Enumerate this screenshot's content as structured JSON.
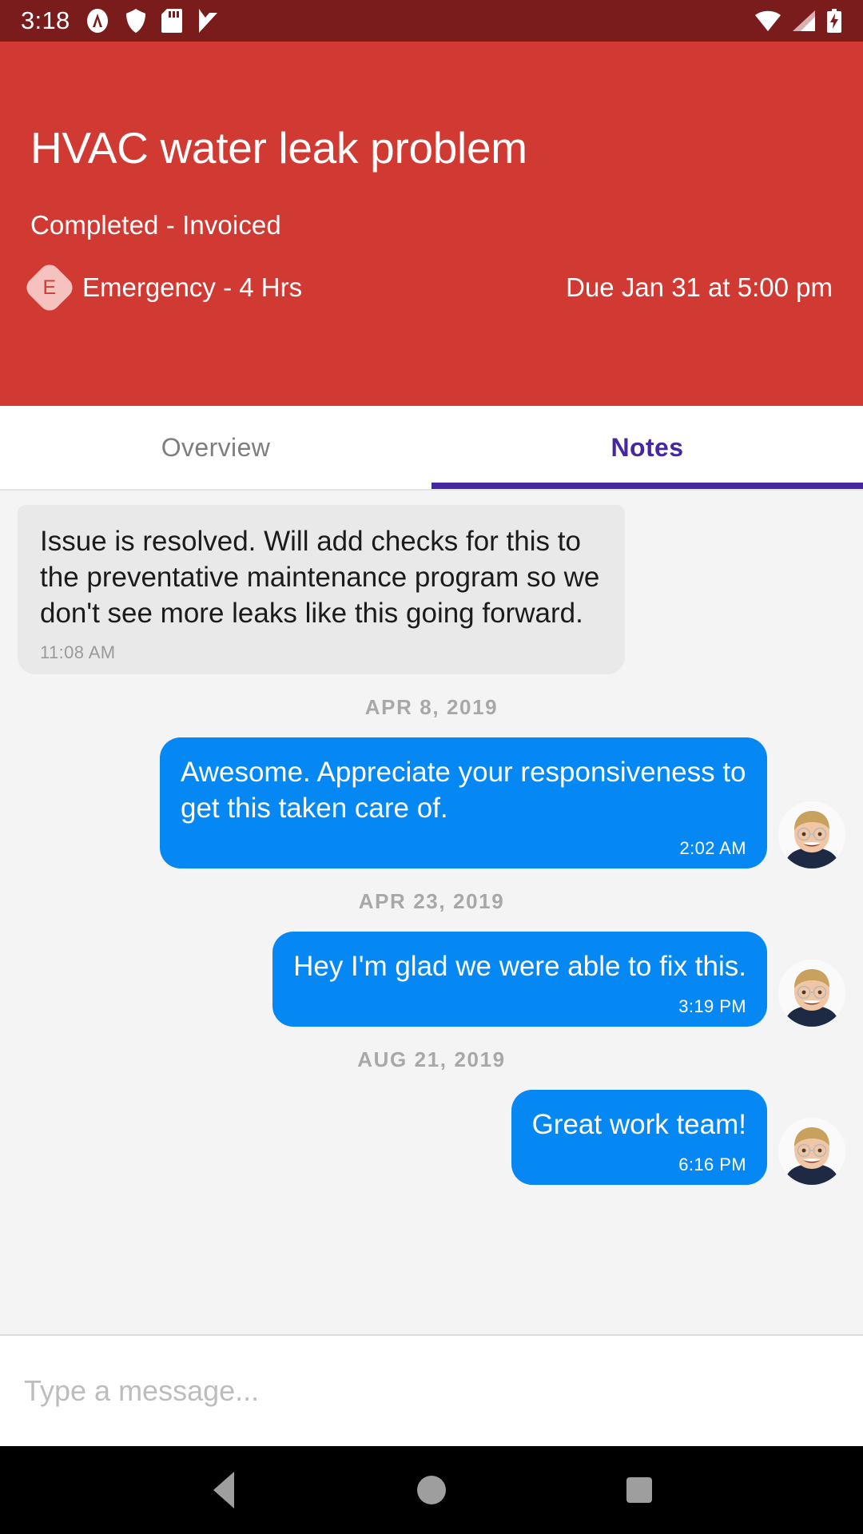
{
  "status_bar": {
    "time": "3:18",
    "left_icons": [
      "avast-icon",
      "shield-icon",
      "sd-card-icon",
      "checkmark-flag-icon"
    ],
    "right_icons": [
      "wifi-icon",
      "cellular-signal-icon",
      "battery-charging-icon"
    ],
    "background_color": "#7A1C1C"
  },
  "header": {
    "title": "HVAC water leak problem",
    "status": "Completed - Invoiced",
    "priority_letter": "E",
    "priority_label": "Emergency - 4 Hrs",
    "due_label": "Due Jan 31 at 5:00 pm",
    "background_color": "#D13A33",
    "badge_color": "#F5C2C0"
  },
  "tabs": {
    "items": [
      {
        "label": "Overview",
        "active": false
      },
      {
        "label": "Notes",
        "active": true
      }
    ],
    "active_color": "#4527A0",
    "inactive_color": "#7E7E7E"
  },
  "conversation": {
    "entries": [
      {
        "kind": "message",
        "side": "incoming",
        "text": "Issue is resolved. Will add checks for this to the preventative maintenance program so we don't see more leaks like this going forward.",
        "time": "11:08 AM",
        "has_avatar": false
      },
      {
        "kind": "date",
        "label": "APR 8, 2019"
      },
      {
        "kind": "message",
        "side": "outgoing",
        "text": "Awesome. Appreciate your responsiveness to get this taken care of.",
        "time": "2:02 AM",
        "has_avatar": true,
        "avatar_name": "user-avatar"
      },
      {
        "kind": "date",
        "label": "APR 23, 2019"
      },
      {
        "kind": "message",
        "side": "outgoing",
        "text": "Hey I'm glad we were able to fix this.",
        "time": "3:19 PM",
        "has_avatar": true,
        "avatar_name": "user-avatar"
      },
      {
        "kind": "date",
        "label": "AUG 21, 2019"
      },
      {
        "kind": "message",
        "side": "outgoing",
        "text": "Great work team!",
        "time": "6:16 PM",
        "has_avatar": true,
        "avatar_name": "user-avatar"
      }
    ],
    "incoming_bubble_color": "#E9E9E9",
    "outgoing_bubble_color": "#0588F4",
    "background_color": "#F4F4F4"
  },
  "composer": {
    "value": "",
    "placeholder": "Type a message..."
  },
  "navbar": {
    "buttons": [
      "back-button",
      "home-button",
      "recents-button"
    ]
  }
}
